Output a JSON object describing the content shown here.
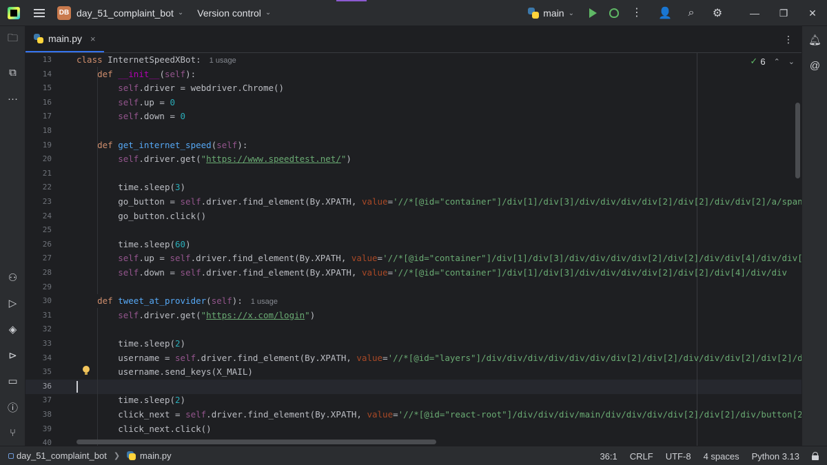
{
  "titlebar": {
    "project_badge": "DB",
    "project_name": "day_51_complaint_bot",
    "version_control": "Version control",
    "run_config": "main"
  },
  "tab": {
    "label": "main.py",
    "close": "×"
  },
  "inspections": {
    "count": "6"
  },
  "editor": {
    "current_line": 36,
    "lines": [
      {
        "n": "13"
      },
      {
        "n": "14"
      },
      {
        "n": "15"
      },
      {
        "n": "16"
      },
      {
        "n": "17"
      },
      {
        "n": "18"
      },
      {
        "n": "19"
      },
      {
        "n": "20"
      },
      {
        "n": "21"
      },
      {
        "n": "22"
      },
      {
        "n": "23"
      },
      {
        "n": "24"
      },
      {
        "n": "25"
      },
      {
        "n": "26"
      },
      {
        "n": "27"
      },
      {
        "n": "28"
      },
      {
        "n": "29"
      },
      {
        "n": "30"
      },
      {
        "n": "31"
      },
      {
        "n": "32"
      },
      {
        "n": "33"
      },
      {
        "n": "34"
      },
      {
        "n": "35"
      },
      {
        "n": "36"
      },
      {
        "n": "37"
      },
      {
        "n": "38"
      },
      {
        "n": "39"
      },
      {
        "n": "40"
      }
    ],
    "code": {
      "l13_kw": "class",
      "l13_name": " InternetSpeedXBot:",
      "l13_hint": "1 usage",
      "l14_kw": "def",
      "l14_fn": "__init__",
      "l14_self": "self",
      "l15_self": "self",
      "l15_rest": ".driver = webdriver.Chrome()",
      "l16_self": "self",
      "l16_rest": ".up = ",
      "l16_num": "0",
      "l17_self": "self",
      "l17_rest": ".down = ",
      "l17_num": "0",
      "l19_kw": "def",
      "l19_fn": "get_internet_speed",
      "l19_self": "self",
      "l20_self": "self",
      "l20_rest": ".driver.get(",
      "l20_url": "https://www.speedtest.net/",
      "l22_a": "time.sleep(",
      "l22_num": "3",
      "l23_a": "go_button = ",
      "l23_self": "self",
      "l23_b": ".driver.find_element(By.XPATH, ",
      "l23_param": "value",
      "l23_str": "'//*[@id=\"container\"]/div[1]/div[3]/div/div/div/div[2]/div[2]/div/div[2]/a/span",
      "l24": "go_button.click()",
      "l26_a": "time.sleep(",
      "l26_num": "60",
      "l27_self1": "self",
      "l27_a": ".up = ",
      "l27_self2": "self",
      "l27_b": ".driver.find_element(By.XPATH, ",
      "l27_param": "value",
      "l27_str": "'//*[@id=\"container\"]/div[1]/div[3]/div/div/div/div[2]/div[2]/div/div[4]/div/div[3",
      "l28_self1": "self",
      "l28_a": ".down = ",
      "l28_self2": "self",
      "l28_b": ".driver.find_element(By.XPATH, ",
      "l28_param": "value",
      "l28_str": "'//*[@id=\"container\"]/div[1]/div[3]/div/div/div/div[2]/div[2]/div[4]/div/div",
      "l30_kw": "def",
      "l30_fn": "tweet_at_provider",
      "l30_self": "self",
      "l30_hint": "1 usage",
      "l31_self": "self",
      "l31_rest": ".driver.get(",
      "l31_url": "https://x.com/login",
      "l33_a": "time.sleep(",
      "l33_num": "2",
      "l34_a": "username = ",
      "l34_self": "self",
      "l34_b": ".driver.find_element(By.XPATH, ",
      "l34_param": "value",
      "l34_str": "'//*[@id=\"layers\"]/div/div/div/div/div/div/div[2]/div[2]/div/div/div[2]/div[2]/di",
      "l35": "username.send_keys(X_MAIL)",
      "l37_a": "time.sleep(",
      "l37_num": "2",
      "l38_a": "click_next = ",
      "l38_self": "self",
      "l38_b": ".driver.find_element(By.XPATH, ",
      "l38_param": "value",
      "l38_str": "'//*[@id=\"react-root\"]/div/div/div/main/div/div/div/div[2]/div[2]/div/button[2",
      "l39": "click_next.click()"
    }
  },
  "statusbar": {
    "project": "day_51_complaint_bot",
    "file": "main.py",
    "position": "36:1",
    "line_sep": "CRLF",
    "encoding": "UTF-8",
    "indent": "4 spaces",
    "interpreter": "Python 3.13"
  },
  "colors": {
    "background": "#1e1f22",
    "panel": "#2b2d30",
    "accent": "#3574f0",
    "keyword": "#cf8e6d",
    "function": "#56a8f5",
    "string": "#6aab73",
    "number": "#2aacb8",
    "self": "#94558d"
  }
}
